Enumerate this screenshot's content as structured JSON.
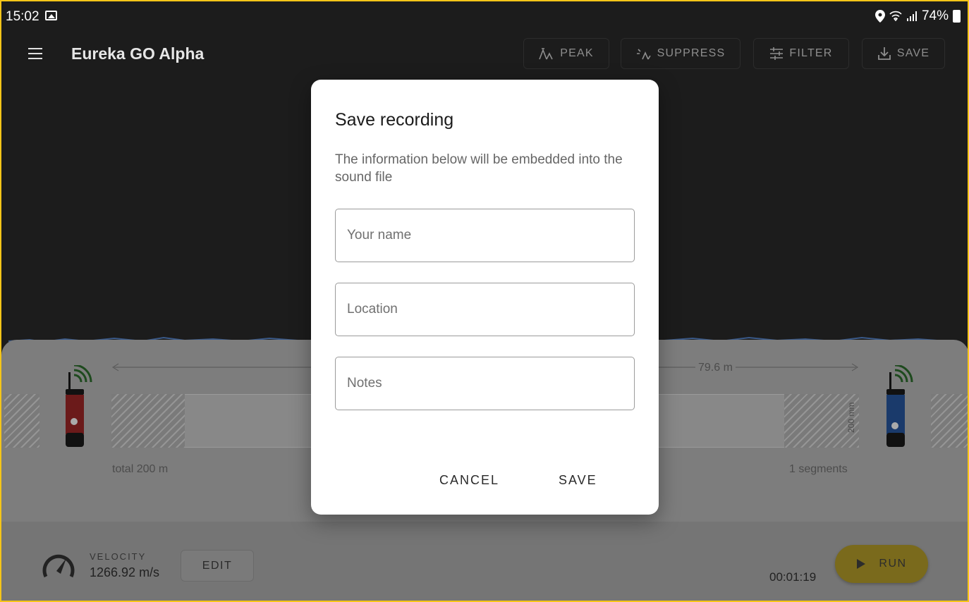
{
  "status_bar": {
    "time": "15:02",
    "battery": "74%",
    "icons": [
      "image-icon",
      "location-icon",
      "wifi-icon",
      "signal-icon",
      "battery-icon"
    ]
  },
  "app_bar": {
    "title": "Eureka GO Alpha",
    "tools": [
      {
        "label": "PEAK",
        "icon": "peak-icon"
      },
      {
        "label": "SUPPRESS",
        "icon": "suppress-icon"
      },
      {
        "label": "FILTER",
        "icon": "filter-icon"
      },
      {
        "label": "SAVE",
        "icon": "download-icon"
      }
    ]
  },
  "pipe": {
    "distance": "79.6 m",
    "total": "total 200 m",
    "segments": "1 segments",
    "segment_length": "200 mm"
  },
  "bottom_bar": {
    "velocity_label": "VELOCITY",
    "velocity_value": "1266.92 m/s",
    "edit_label": "EDIT",
    "timer": "00:01:19",
    "run_label": "RUN"
  },
  "dialog": {
    "title": "Save recording",
    "description": "The information below will be embedded into the sound file",
    "fields": {
      "name_placeholder": "Your name",
      "location_placeholder": "Location",
      "notes_placeholder": "Notes"
    },
    "cancel_label": "CANCEL",
    "save_label": "SAVE"
  },
  "colors": {
    "accent": "#f5c518",
    "sensor_left": "#c62828",
    "sensor_right": "#1565c0",
    "signal": "#2e7d32"
  }
}
